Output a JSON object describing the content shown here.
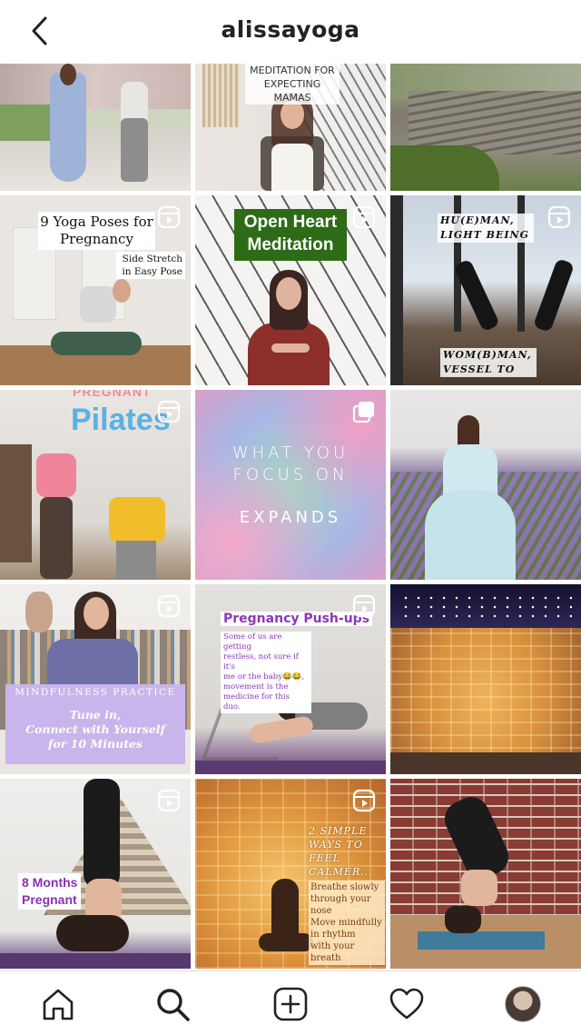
{
  "header": {
    "title": "alissayoga",
    "back_icon": "chevron-left-icon"
  },
  "posts": [
    {
      "id": 1,
      "caption": "MEDITATION FOR\nEXPECTING MAMAS"
    },
    {
      "id": 2,
      "caption": ""
    },
    {
      "id": 3,
      "caption": ""
    },
    {
      "id": 4,
      "title": "9 Yoga Poses for\nPregnancy",
      "sub": "Side Stretch\nin Easy Pose"
    },
    {
      "id": 5,
      "title": "Open Heart\nMeditation"
    },
    {
      "id": 6,
      "top": "HU(E)MAN,\nLIGHT BEING",
      "bottom": "WOM(B)MAN,\nVESSEL TO"
    },
    {
      "id": 7,
      "top": "PREGNANT",
      "title": "Pilates"
    },
    {
      "id": 8,
      "line1": "WHAT YOU\nFOCUS ON",
      "line2": "EXPANDS"
    },
    {
      "id": 9,
      "caption": ""
    },
    {
      "id": 10,
      "kicker": "MINDFULNESS PRACTICE",
      "title": "Tune in,\nConnect with Yourself\nfor 10 Minutes"
    },
    {
      "id": 11,
      "title": "Pregnancy Push-ups",
      "body": "Some of us are getting\nrestless, not sure if it's\nme or the baby😂😂,\nmovement is the\nmedicine for this duo."
    },
    {
      "id": 12,
      "caption": ""
    },
    {
      "id": 13,
      "title": "8 Months\nPregnant"
    },
    {
      "id": 14,
      "title": "2 SIMPLE\nWAYS TO\nFEEL\nCALMER...",
      "body": "Breathe slowly\nthrough your nose\nMove mindfully\nin rhythm\nwith your breath"
    },
    {
      "id": 15,
      "caption": ""
    }
  ],
  "nav": {
    "home_icon": "home-icon",
    "search_icon": "search-icon",
    "add_icon": "add-post-icon",
    "activity_icon": "heart-icon",
    "profile_icon": "profile-avatar"
  }
}
